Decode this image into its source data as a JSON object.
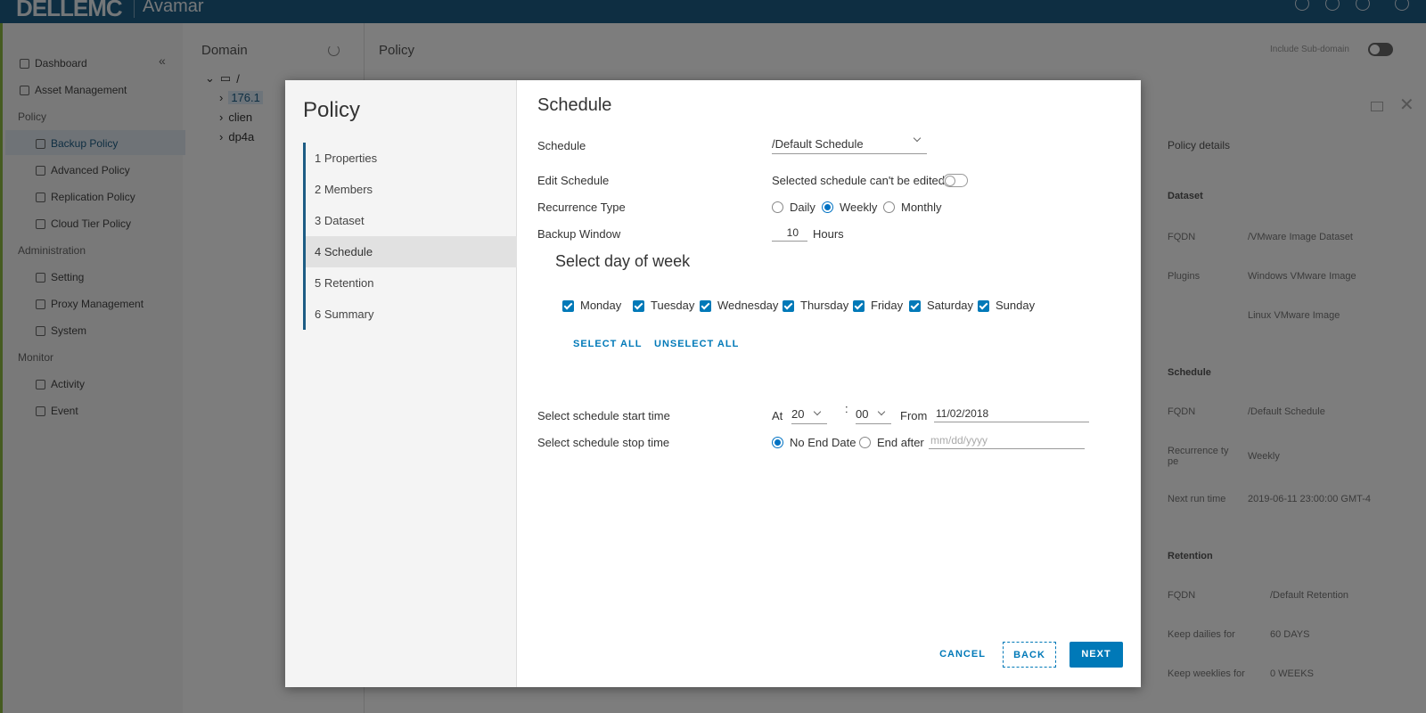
{
  "topbar": {
    "brand": "DELLEMC",
    "product": "Avamar"
  },
  "sidebar": {
    "items": [
      {
        "label": "Dashboard",
        "type": "item"
      },
      {
        "label": "Asset Management",
        "type": "item"
      },
      {
        "label": "Policy",
        "type": "header"
      },
      {
        "label": "Backup Policy",
        "type": "sub",
        "active": true
      },
      {
        "label": "Advanced Policy",
        "type": "sub"
      },
      {
        "label": "Replication Policy",
        "type": "sub"
      },
      {
        "label": "Cloud Tier Policy",
        "type": "sub"
      },
      {
        "label": "Administration",
        "type": "header"
      },
      {
        "label": "Setting",
        "type": "sub"
      },
      {
        "label": "Proxy Management",
        "type": "sub"
      },
      {
        "label": "System",
        "type": "sub"
      },
      {
        "label": "Monitor",
        "type": "header"
      },
      {
        "label": "Activity",
        "type": "sub"
      },
      {
        "label": "Event",
        "type": "sub"
      }
    ]
  },
  "domain": {
    "title": "Domain",
    "tree": [
      "/",
      "176.1",
      "clien",
      "dp4a"
    ]
  },
  "main": {
    "title": "Policy",
    "include_sub": "Include Sub-domain"
  },
  "details": {
    "header": "Policy details",
    "dataset_section": "Dataset",
    "dataset_fqdn_k": "FQDN",
    "dataset_fqdn_v": "/VMware Image Dataset",
    "plugins_k": "Plugins",
    "plugins_v1": "Windows VMware Image",
    "plugins_v2": "Linux VMware Image",
    "schedule_section": "Schedule",
    "schedule_fqdn_k": "FQDN",
    "schedule_fqdn_v": "/Default Schedule",
    "recurrence_k": "Recurrence ty pe",
    "recurrence_v": "Weekly",
    "next_run_k": "Next run time",
    "next_run_v": "2019-06-11 23:00:00 GMT-4",
    "retention_section": "Retention",
    "retention_fqdn_k": "FQDN",
    "retention_fqdn_v": "/Default Retention",
    "keep_dailies_k": "Keep dailies for",
    "keep_dailies_v": "60 DAYS",
    "keep_weeklies_k": "Keep weeklies for",
    "keep_weeklies_v": "0 WEEKS"
  },
  "modal": {
    "title": "Policy",
    "steps": [
      "1  Properties",
      "2  Members",
      "3  Dataset",
      "4  Schedule",
      "5  Retention",
      "6  Summary"
    ],
    "current_step": 3,
    "section_title": "Schedule",
    "schedule_label": "Schedule",
    "schedule_value": "/Default Schedule",
    "edit_schedule_label": "Edit Schedule",
    "edit_schedule_text": "Selected schedule can't be edited",
    "recurrence_label": "Recurrence Type",
    "recurrence_options": [
      "Daily",
      "Weekly",
      "Monthly"
    ],
    "recurrence_selected": "Weekly",
    "backup_window_label": "Backup Window",
    "backup_window_value": "10",
    "backup_window_unit": "Hours",
    "day_title": "Select day of week",
    "days": [
      "Monday",
      "Tuesday",
      "Wednesday",
      "Thursday",
      "Friday",
      "Saturday",
      "Sunday"
    ],
    "select_all": "SELECT ALL",
    "unselect_all": "UNSELECT ALL",
    "start_time_label": "Select schedule start time",
    "at_label": "At",
    "hour_value": "20",
    "time_colon": ":",
    "minute_value": "00",
    "from_label": "From",
    "from_value": "11/02/2018",
    "stop_time_label": "Select schedule stop time",
    "no_end_label": "No End Date",
    "end_after_label": "End after",
    "end_after_placeholder": "mm/dd/yyyy",
    "cancel": "CANCEL",
    "back": "BACK",
    "next": "NEXT"
  },
  "colors": {
    "accent": "#0079b8",
    "topbar": "#1d5c84",
    "sidebar_stripe": "#8ab640"
  }
}
